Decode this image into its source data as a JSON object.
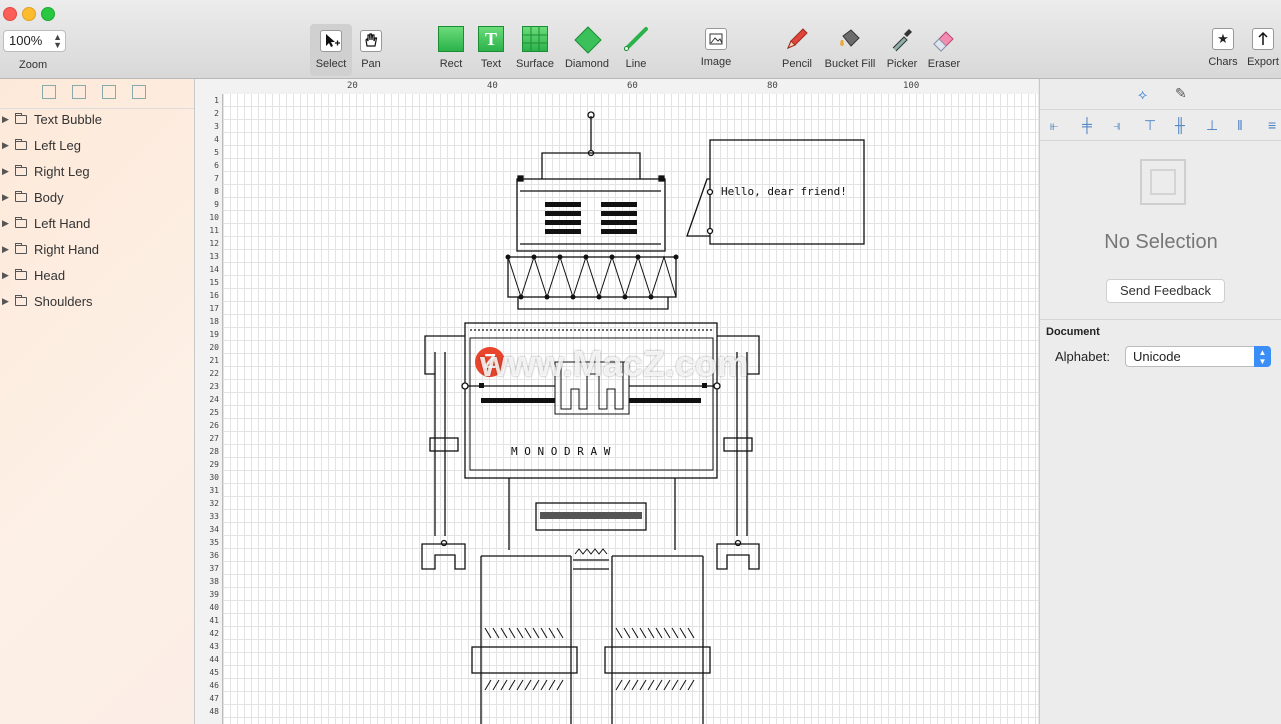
{
  "window": {
    "zoom": {
      "value": "100%",
      "label": "Zoom"
    },
    "tools": [
      {
        "id": "select",
        "label": "Select",
        "icon": "select-arrow-icon",
        "selected": true
      },
      {
        "id": "pan",
        "label": "Pan",
        "icon": "hand-icon"
      },
      {
        "id": "rect",
        "label": "Rect",
        "icon": "rectangle-icon"
      },
      {
        "id": "text",
        "label": "Text",
        "icon": "text-icon"
      },
      {
        "id": "surface",
        "label": "Surface",
        "icon": "surface-grid-icon"
      },
      {
        "id": "diamond",
        "label": "Diamond",
        "icon": "diamond-icon"
      },
      {
        "id": "line",
        "label": "Line",
        "icon": "line-icon"
      },
      {
        "id": "image",
        "label": "Image",
        "icon": "image-icon"
      },
      {
        "id": "pencil",
        "label": "Pencil",
        "icon": "pencil-icon"
      },
      {
        "id": "bucket",
        "label": "Bucket Fill",
        "icon": "bucket-fill-icon"
      },
      {
        "id": "picker",
        "label": "Picker",
        "icon": "picker-icon"
      },
      {
        "id": "eraser",
        "label": "Eraser",
        "icon": "eraser-icon"
      },
      {
        "id": "chars",
        "label": "Chars",
        "icon": "star-chars-icon"
      },
      {
        "id": "export",
        "label": "Export",
        "icon": "export-icon"
      }
    ]
  },
  "sidebar": {
    "layers": [
      "Text Bubble",
      "Left Leg",
      "Right Leg",
      "Body",
      "Left Hand",
      "Right Hand",
      "Head",
      "Shoulders"
    ]
  },
  "canvas": {
    "ruler_top": [
      "20",
      "40",
      "60",
      "80",
      "100"
    ],
    "ruler_left": [
      "1",
      "2",
      "3",
      "4",
      "5",
      "6",
      "7",
      "8",
      "9",
      "10",
      "11",
      "12",
      "13",
      "14",
      "15",
      "16",
      "17",
      "18",
      "19",
      "20",
      "21",
      "22",
      "23",
      "24",
      "25",
      "26",
      "27",
      "28",
      "29",
      "30",
      "31",
      "32",
      "33",
      "34",
      "35",
      "36",
      "37",
      "38",
      "39",
      "40",
      "41",
      "42",
      "43",
      "44",
      "45",
      "46",
      "47",
      "48"
    ],
    "speech_text": "Hello, dear friend!",
    "body_text": "M O N O D R A W",
    "watermark": "www.MacZ.com",
    "watermark_logo": "Z"
  },
  "inspector": {
    "no_selection": "No Selection",
    "send_feedback": "Send Feedback",
    "document_title": "Document",
    "alphabet_label": "Alphabet:",
    "alphabet_value": "Unicode"
  }
}
